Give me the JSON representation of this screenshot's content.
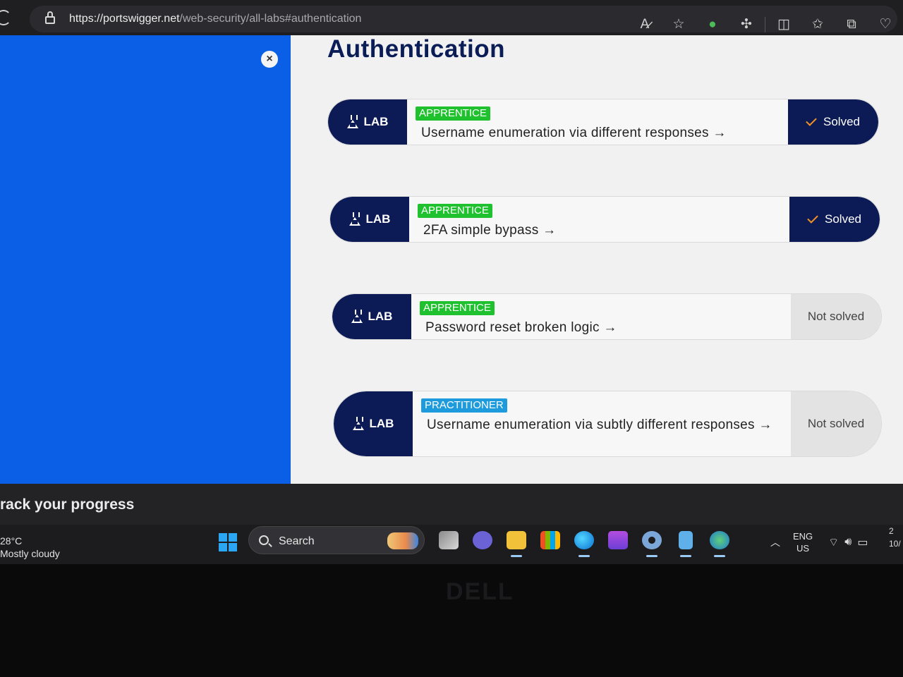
{
  "browser": {
    "url_host": "https://portswigger.net",
    "url_path": "/web-security/all-labs#authentication"
  },
  "page": {
    "title": "Authentication",
    "close_label": "×",
    "labs": [
      {
        "tag": "LAB",
        "level": "APPRENTICE",
        "title": "Username enumeration via different responses →",
        "status": "Solved"
      },
      {
        "tag": "LAB",
        "level": "APPRENTICE",
        "title": "2FA simple bypass →",
        "status": "Solved"
      },
      {
        "tag": "LAB",
        "level": "APPRENTICE",
        "title": "Password reset broken logic →",
        "status": "Not solved"
      },
      {
        "tag": "LAB",
        "level": "PRACTITIONER",
        "title": "Username enumeration via subtly different responses →",
        "status": "Not solved"
      }
    ]
  },
  "progress_strip": {
    "text": "rack your progress"
  },
  "taskbar": {
    "weather_temp": "28°C",
    "weather_desc": "Mostly cloudy",
    "search_label": "Search",
    "lang_primary": "ENG",
    "lang_secondary": "US",
    "clock_line1": "2",
    "clock_line2": "10/"
  },
  "hardware": {
    "brand": "DELL"
  },
  "colors": {
    "accent_navy": "#0c1a55",
    "apprentice_green": "#1fc22e",
    "practitioner_blue": "#1e9bdc",
    "panel_blue": "#0b5ee6",
    "check_orange": "#f39325"
  }
}
